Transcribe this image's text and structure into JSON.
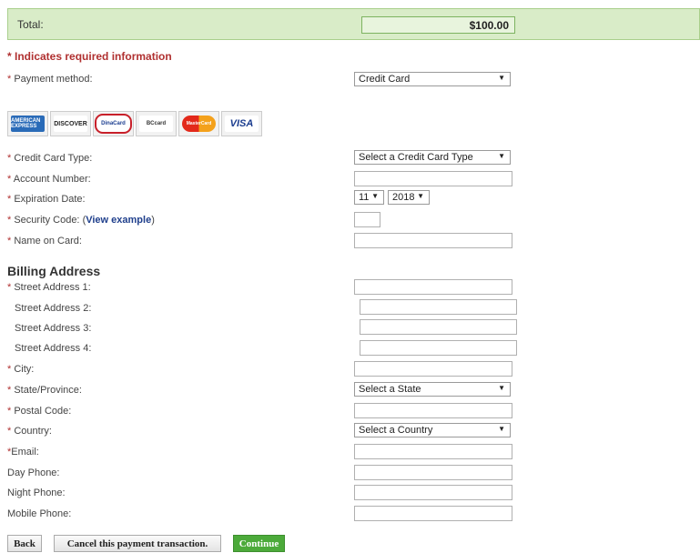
{
  "total": {
    "label": "Total:",
    "value": "$100.00"
  },
  "required_note": "* Indicates required information",
  "required_star": "*",
  "payment_method": {
    "label": "Payment method:",
    "value": "Credit Card"
  },
  "cards": [
    "AMERICAN EXPRESS",
    "DISCOVER",
    "DinaCard",
    "BCcard",
    "MasterCard",
    "VISA"
  ],
  "fields": {
    "card_type": {
      "label": "Credit Card Type:",
      "value": "Select a Credit Card Type"
    },
    "account_number": {
      "label": "Account Number:"
    },
    "expiration": {
      "label": "Expiration Date:",
      "month": "11",
      "year": "2018"
    },
    "security": {
      "label": "Security Code:",
      "link": "View example",
      "open_paren": "(",
      "close_paren": ")"
    },
    "name_on_card": {
      "label": "Name on Card:"
    }
  },
  "billing": {
    "title": "Billing Address",
    "street1": "Street Address 1:",
    "street2": "Street Address 2:",
    "street3": "Street Address 3:",
    "street4": "Street Address 4:",
    "city": "City:",
    "state": {
      "label": "State/Province:",
      "value": "Select a State"
    },
    "postal": "Postal Code:",
    "country": {
      "label": "Country:",
      "value": "Select a Country"
    },
    "email": "Email:",
    "day_phone": "Day Phone:",
    "night_phone": "Night Phone:",
    "mobile_phone": "Mobile Phone:"
  },
  "buttons": {
    "back": "Back",
    "cancel": "Cancel this payment transaction.",
    "continue": "Continue"
  },
  "colors": {
    "accent_green": "#4caa3a",
    "required_red": "#b03030",
    "link_blue": "#1f3f8c"
  }
}
